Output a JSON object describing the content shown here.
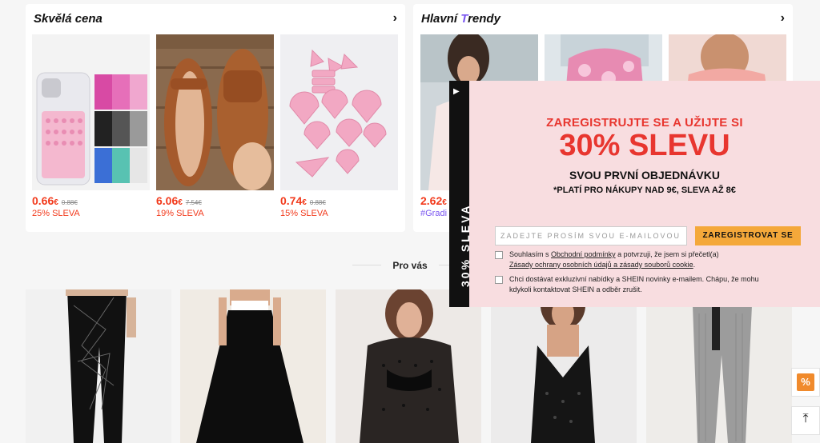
{
  "deals": {
    "title": "Skvělá cena",
    "items": [
      {
        "price": "0.66",
        "currency": "€",
        "old_price": "0.88€",
        "discount": "25% SLEVA"
      },
      {
        "price": "6.06",
        "currency": "€",
        "old_price": "7.54€",
        "discount": "19% SLEVA"
      },
      {
        "price": "0.74",
        "currency": "€",
        "old_price": "0.88€",
        "discount": "15% SLEVA"
      }
    ]
  },
  "trends": {
    "title_prefix": "Hlavní ",
    "title_suffix": "rendy",
    "items": [
      {
        "price": "2.62",
        "currency": "€",
        "hashtag": "#Gradi"
      }
    ]
  },
  "for_you": {
    "title": "Pro vás"
  },
  "popup": {
    "tab_label": "30% SLEVA",
    "headline": "ZAREGISTRUJTE SE A UŽIJTE SI",
    "big": "30% SLEVU",
    "sub": "SVOU PRVNÍ OBJEDNÁVKU",
    "note": "*PLATÍ PRO NÁKUPY NAD 9€, SLEVA AŽ 8€",
    "email_placeholder": "ZADEJTE PROSÍM SVOU E-MAILOVOU",
    "register_button": "ZAREGISTROVAT SE",
    "consent1_a": "Souhlasím s ",
    "consent1_link1": "Obchodní podmínky",
    "consent1_b": " a potvrzuji, že jsem si přečetl(a)",
    "consent1_link2": "Zásady ochrany osobních údajů a zásady souborů cookie",
    "consent1_c": ".",
    "consent2": "Chci dostávat exkluzivní nabídky a SHEIN novinky e-mailem. Chápu, že mohu kdykoli kontaktovat SHEIN a odběr zrušit."
  },
  "side": {
    "coupon_glyph": "%",
    "top_glyph": "⤒"
  }
}
